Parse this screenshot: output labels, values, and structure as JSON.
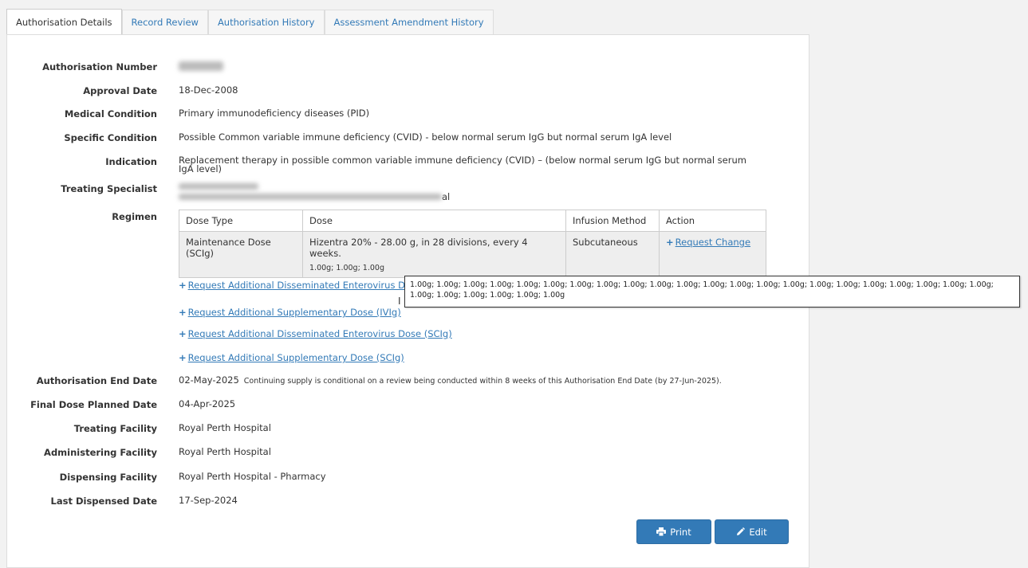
{
  "tabs": [
    {
      "label": "Authorisation Details"
    },
    {
      "label": "Record Review"
    },
    {
      "label": "Authorisation History"
    },
    {
      "label": "Assessment Amendment History"
    }
  ],
  "fields": {
    "authorisation_number": {
      "label": "Authorisation Number"
    },
    "approval_date": {
      "label": "Approval Date",
      "value": "18-Dec-2008"
    },
    "medical_condition": {
      "label": "Medical Condition",
      "value": "Primary immunodeficiency diseases (PID)"
    },
    "specific_condition": {
      "label": "Specific Condition",
      "value": "Possible Common variable immune deficiency (CVID) - below normal serum IgG but normal serum IgA level"
    },
    "indication": {
      "label": "Indication",
      "value": "Replacement therapy in possible common variable immune deficiency (CVID) – (below normal serum IgG but normal serum IgA level)"
    },
    "treating_specialist": {
      "label": "Treating Specialist",
      "value_tail": "al"
    },
    "regimen": {
      "label": "Regimen"
    },
    "authorisation_end_date": {
      "label": "Authorisation End Date",
      "value": "02-May-2025",
      "note": "Continuing supply is conditional on a review being conducted within 8 weeks of this Authorisation End Date (by 27-Jun-2025)."
    },
    "final_dose_planned_date": {
      "label": "Final Dose Planned Date",
      "value": "04-Apr-2025"
    },
    "treating_facility": {
      "label": "Treating Facility",
      "value": "Royal Perth Hospital"
    },
    "administering_facility": {
      "label": "Administering Facility",
      "value": "Royal Perth Hospital"
    },
    "dispensing_facility": {
      "label": "Dispensing Facility",
      "value": "Royal Perth Hospital - Pharmacy"
    },
    "last_dispensed_date": {
      "label": "Last Dispensed Date",
      "value": "17-Sep-2024"
    }
  },
  "regimen_table": {
    "headers": [
      "Dose Type",
      "Dose",
      "Infusion Method",
      "Action"
    ],
    "row": {
      "dose_type": "Maintenance Dose (SCIg)",
      "dose": "Hizentra 20% - 28.00 g, in 28 divisions, every 4 weeks.",
      "dose_sub": "1.00g; 1.00g; 1.00g",
      "infusion_method": "Subcutaneous",
      "action": "Request Change"
    }
  },
  "requests": [
    "Request Additional Disseminated Enterovirus D",
    "Request Additional Supplementary Dose (IVIg)",
    "Request Additional Disseminated Enterovirus Dose (SCIg)",
    "Request Additional Supplementary Dose (SCIg)"
  ],
  "tooltip": {
    "text": "1.00g; 1.00g; 1.00g; 1.00g; 1.00g; 1.00g; 1.00g; 1.00g; 1.00g; 1.00g; 1.00g; 1.00g; 1.00g; 1.00g; 1.00g; 1.00g; 1.00g; 1.00g; 1.00g; 1.00g; 1.00g; 1.00g; 1.00g; 1.00g; 1.00g; 1.00g; 1.00g; 1.00g"
  },
  "buttons": {
    "print": "Print",
    "edit": "Edit"
  },
  "colors": {
    "link": "#337ab7",
    "button": "#337ab7"
  }
}
